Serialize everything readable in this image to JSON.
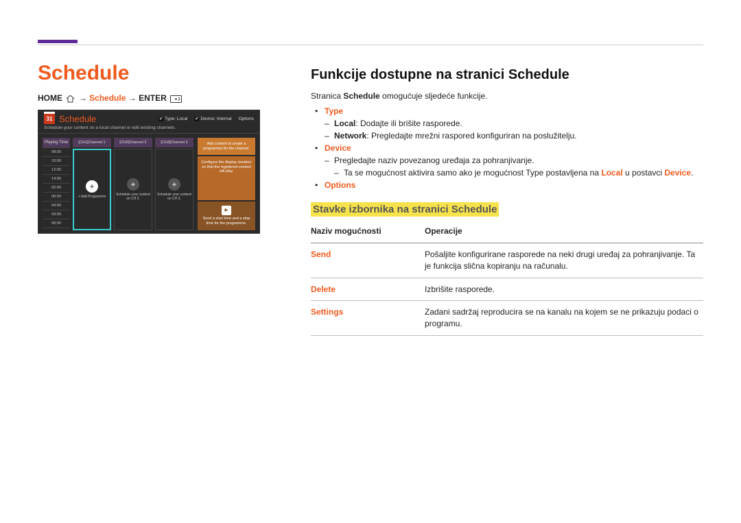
{
  "page": {
    "title": "Schedule"
  },
  "breadcrumb": {
    "home": "HOME",
    "mid": "Schedule",
    "enter": "ENTER",
    "arrow": " → "
  },
  "mock": {
    "title": "Schedule",
    "calNum": "31",
    "type": "Type: Local",
    "device": "Device: Internal",
    "options": "Options",
    "sub": "Schedule your content on a local channel or edit existing channels.",
    "timesHead": "Playing Time",
    "times": [
      "08:00",
      "10:00",
      "12:00",
      "14:00",
      "02:00",
      "00:00",
      "04:00",
      "03:00",
      "00:00",
      "00:00"
    ],
    "ch1Head": "[CH1]Channel 1",
    "ch1Txt": "+ Add Programme",
    "ch2Head": "[CH2]Channel 2",
    "ch2Txt": "Schedule your content on CH 2.",
    "ch3Head": "[CH3]Channel 3",
    "ch3Txt": "Schedule your content on CH 3.",
    "side1": "Add content to create a programme for the channel.",
    "side2": "Configure the display duration so that the registered content will play.",
    "side3": "Send a start time and a stop time for the programme."
  },
  "main": {
    "heading": "Funkcije dostupne na stranici Schedule",
    "intro_pre": "Stranica ",
    "intro_hl": "Schedule",
    "intro_post": " omogućuje sljedeće funkcije.",
    "type": "Type",
    "type_local_b": "Local",
    "type_local_txt": ": Dodajte ili brišite rasporede.",
    "type_net_b": "Network",
    "type_net_txt": ": Pregledajte mrežni raspored konfiguriran na poslužitelju.",
    "device": "Device",
    "device_txt": "Pregledajte naziv povezanog uređaja za pohranjivanje.",
    "device_note_pre": "Ta se mogućnost aktivira samo ako je mogućnost ",
    "device_note_type": "Type",
    "device_note_mid": " postavljena na ",
    "device_note_local": "Local",
    "device_note_mid2": " u postavci ",
    "device_note_dev": "Device",
    "device_note_end": ".",
    "options": "Options",
    "subhead": "Stavke izbornika na stranici Schedule",
    "tbl_head1": "Naziv mogućnosti",
    "tbl_head2": "Operacije",
    "rows": {
      "send": {
        "name": "Send",
        "desc": "Pošaljite konfigurirane rasporede na neki drugi uređaj za pohranjivanje. Ta je funkcija slična kopiranju na računalu."
      },
      "delete": {
        "name": "Delete",
        "desc": "Izbrišite rasporede."
      },
      "settings": {
        "name": "Settings",
        "desc": "Zadani sadržaj reproducira se na kanalu na kojem se ne prikazuju podaci o programu."
      }
    }
  }
}
